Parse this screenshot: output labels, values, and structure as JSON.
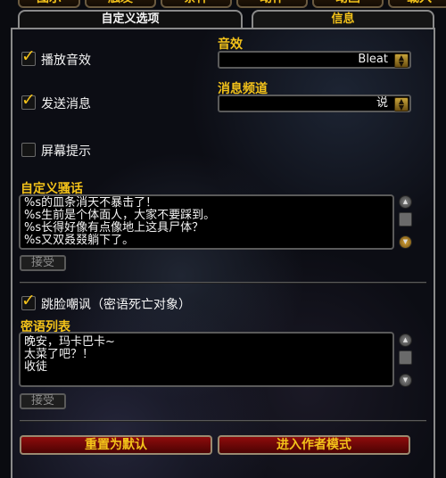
{
  "top_tabs": [
    "图示",
    "触发",
    "条件",
    "动作",
    "动画",
    "载入"
  ],
  "sub_tabs": {
    "active": "自定义选项",
    "inactive": "信息"
  },
  "options": {
    "play_sound": {
      "label": "播放音效",
      "checked": true
    },
    "send_message": {
      "label": "发送消息",
      "checked": true
    },
    "screen_alert": {
      "label": "屏幕提示",
      "checked": false
    }
  },
  "sound": {
    "label": "音效",
    "value": "Bleat"
  },
  "channel": {
    "label": "消息频道",
    "value": "说"
  },
  "taunts": {
    "label": "自定义骚话",
    "lines": [
      "%s的皿条消天不暴击了！",
      "%s生前是个体面人，大家不要踩到。",
      "%s长得好像有点像地上这具尸体？",
      "%s又双叒叕躺下了。"
    ],
    "accept_button": "接受"
  },
  "mock_dead": {
    "label": "跳脸嘲讽（密语死亡对象）",
    "checked": true
  },
  "whispers": {
    "label": "密语列表",
    "lines": [
      "晚安，玛卡巴卡~",
      "太菜了吧？！",
      "收徒"
    ],
    "accept_button": "接受"
  },
  "buttons": {
    "reset": "重置为默认",
    "author_mode": "进入作者模式"
  },
  "colors": {
    "gold": "#f3c21a",
    "red_button": "#8e0c0c"
  }
}
